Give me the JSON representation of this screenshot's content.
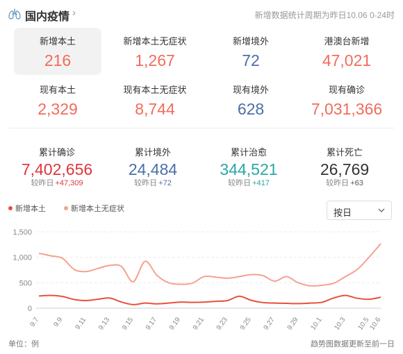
{
  "header": {
    "title": "国内疫情",
    "period": "新增数据统计周期为昨日10.06 0-24时"
  },
  "stats": [
    {
      "label": "新增本土",
      "value": "216",
      "color": "red",
      "active": true
    },
    {
      "label": "新增本土无症状",
      "value": "1,267",
      "color": "red"
    },
    {
      "label": "新增境外",
      "value": "72",
      "color": "blue"
    },
    {
      "label": "港澳台新增",
      "value": "47,021",
      "color": "red"
    },
    {
      "label": "现有本土",
      "value": "2,329",
      "color": "red"
    },
    {
      "label": "现有本土无症状",
      "value": "8,744",
      "color": "red"
    },
    {
      "label": "现有境外",
      "value": "628",
      "color": "blue"
    },
    {
      "label": "现有确诊",
      "value": "7,031,366",
      "color": "red"
    }
  ],
  "cumulative": [
    {
      "label": "累计确诊",
      "value": "7,402,656",
      "delta_label": "较昨日",
      "delta": "+47,309",
      "color": "dark-red"
    },
    {
      "label": "累计境外",
      "value": "24,484",
      "delta_label": "较昨日",
      "delta": "+72",
      "color": "blue"
    },
    {
      "label": "累计治愈",
      "value": "344,521",
      "delta_label": "较昨日",
      "delta": "+417",
      "color": "teal"
    },
    {
      "label": "累计死亡",
      "value": "26,769",
      "delta_label": "较昨日",
      "delta": "+63",
      "color": "dark"
    }
  ],
  "legend": {
    "series1": "新增本土",
    "series2": "新增本土无症状"
  },
  "select": {
    "value": "按日"
  },
  "footer": {
    "unit": "单位：例",
    "note": "趋势图数据更新至前一日"
  },
  "colors": {
    "series1": "#e8503a",
    "series2": "#f6a08e"
  },
  "chart_data": {
    "type": "line",
    "x": [
      "9.7",
      "9.8",
      "9.9",
      "9.10",
      "9.11",
      "9.12",
      "9.13",
      "9.14",
      "9.15",
      "9.16",
      "9.17",
      "9.18",
      "9.19",
      "9.20",
      "9.21",
      "9.22",
      "9.23",
      "9.24",
      "9.25",
      "9.26",
      "9.27",
      "9.28",
      "9.29",
      "9.30",
      "10.1",
      "10.2",
      "10.3",
      "10.4",
      "10.5",
      "10.6"
    ],
    "x_tick_labels": [
      "9.7",
      "9.9",
      "9.11",
      "9.13",
      "9.15",
      "9.17",
      "9.19",
      "9.21",
      "9.23",
      "9.25",
      "9.27",
      "9.29",
      "10.1",
      "10.3",
      "10.5",
      "10.6"
    ],
    "y_ticks": [
      "0",
      "500",
      "1,000",
      "1,500"
    ],
    "ylim": [
      0,
      1500
    ],
    "series": [
      {
        "name": "新增本土",
        "values": [
          240,
          250,
          230,
          170,
          150,
          175,
          200,
          120,
          70,
          100,
          85,
          100,
          120,
          115,
          120,
          135,
          150,
          235,
          155,
          110,
          100,
          95,
          90,
          100,
          115,
          200,
          250,
          195,
          175,
          216
        ]
      },
      {
        "name": "新增本土无症状",
        "values": [
          1080,
          1030,
          980,
          760,
          720,
          780,
          840,
          820,
          520,
          920,
          650,
          500,
          470,
          490,
          620,
          610,
          590,
          620,
          660,
          640,
          530,
          620,
          500,
          440,
          450,
          490,
          620,
          760,
          1000,
          1267
        ]
      }
    ]
  }
}
